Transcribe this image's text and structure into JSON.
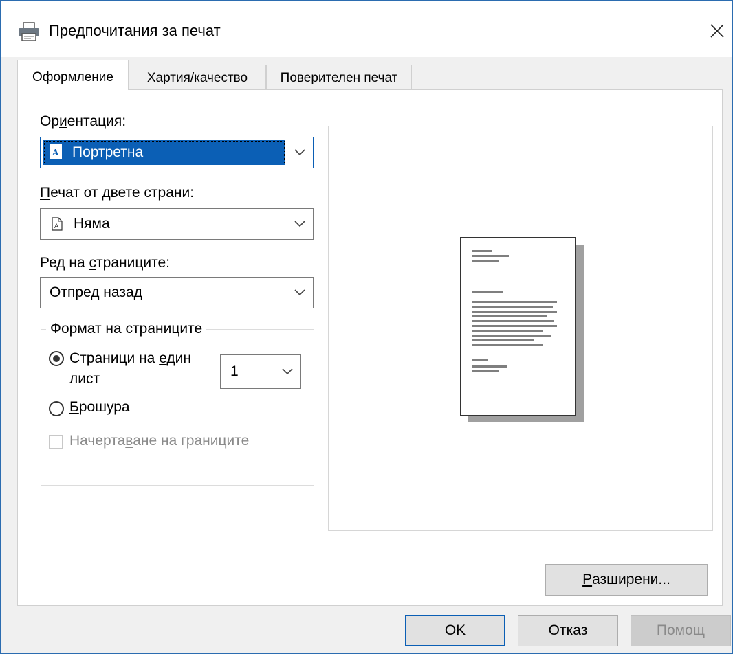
{
  "window": {
    "title": "Предпочитания за печат",
    "icons": {
      "app": "printer-icon",
      "close": "close-icon"
    }
  },
  "tabs": [
    {
      "label": "Оформление",
      "active": true
    },
    {
      "label": "Хартия/качество",
      "active": false
    },
    {
      "label": "Поверителен печат",
      "active": false
    }
  ],
  "orientation": {
    "label_pre": "Ор",
    "label_u": "и",
    "label_post": "ентация:",
    "value": "Портретна",
    "icon": "portrait-page-icon"
  },
  "duplex": {
    "label_u": "П",
    "label_post": "ечат от двете страни:",
    "value": "Няма",
    "icon": "single-side-page-icon"
  },
  "page_order": {
    "label_pre": "Ред на ",
    "label_u": "с",
    "label_post": "траниците:",
    "value": "Отпред назад"
  },
  "page_format": {
    "title": "Формат на страниците",
    "pages_per_sheet": {
      "label_pre": "Страници на ",
      "label_u": "е",
      "label_post": "дин",
      "label_line2": "лист",
      "selected": true,
      "value": "1"
    },
    "booklet": {
      "label_u": "Б",
      "label_post": "рошура",
      "selected": false
    },
    "draw_borders": {
      "label_pre": "Начерта",
      "label_u": "в",
      "label_post": "ане на границите",
      "checked": false,
      "enabled": false
    }
  },
  "advanced_button": {
    "label_u": "Р",
    "label_post": "азширени..."
  },
  "footer": {
    "ok": "OK",
    "cancel": "Отказ",
    "help": "Помощ"
  },
  "colors": {
    "accent": "#0b5fb5",
    "window_border": "#2b6cb0",
    "dialog_bg": "#f0f0f0"
  }
}
